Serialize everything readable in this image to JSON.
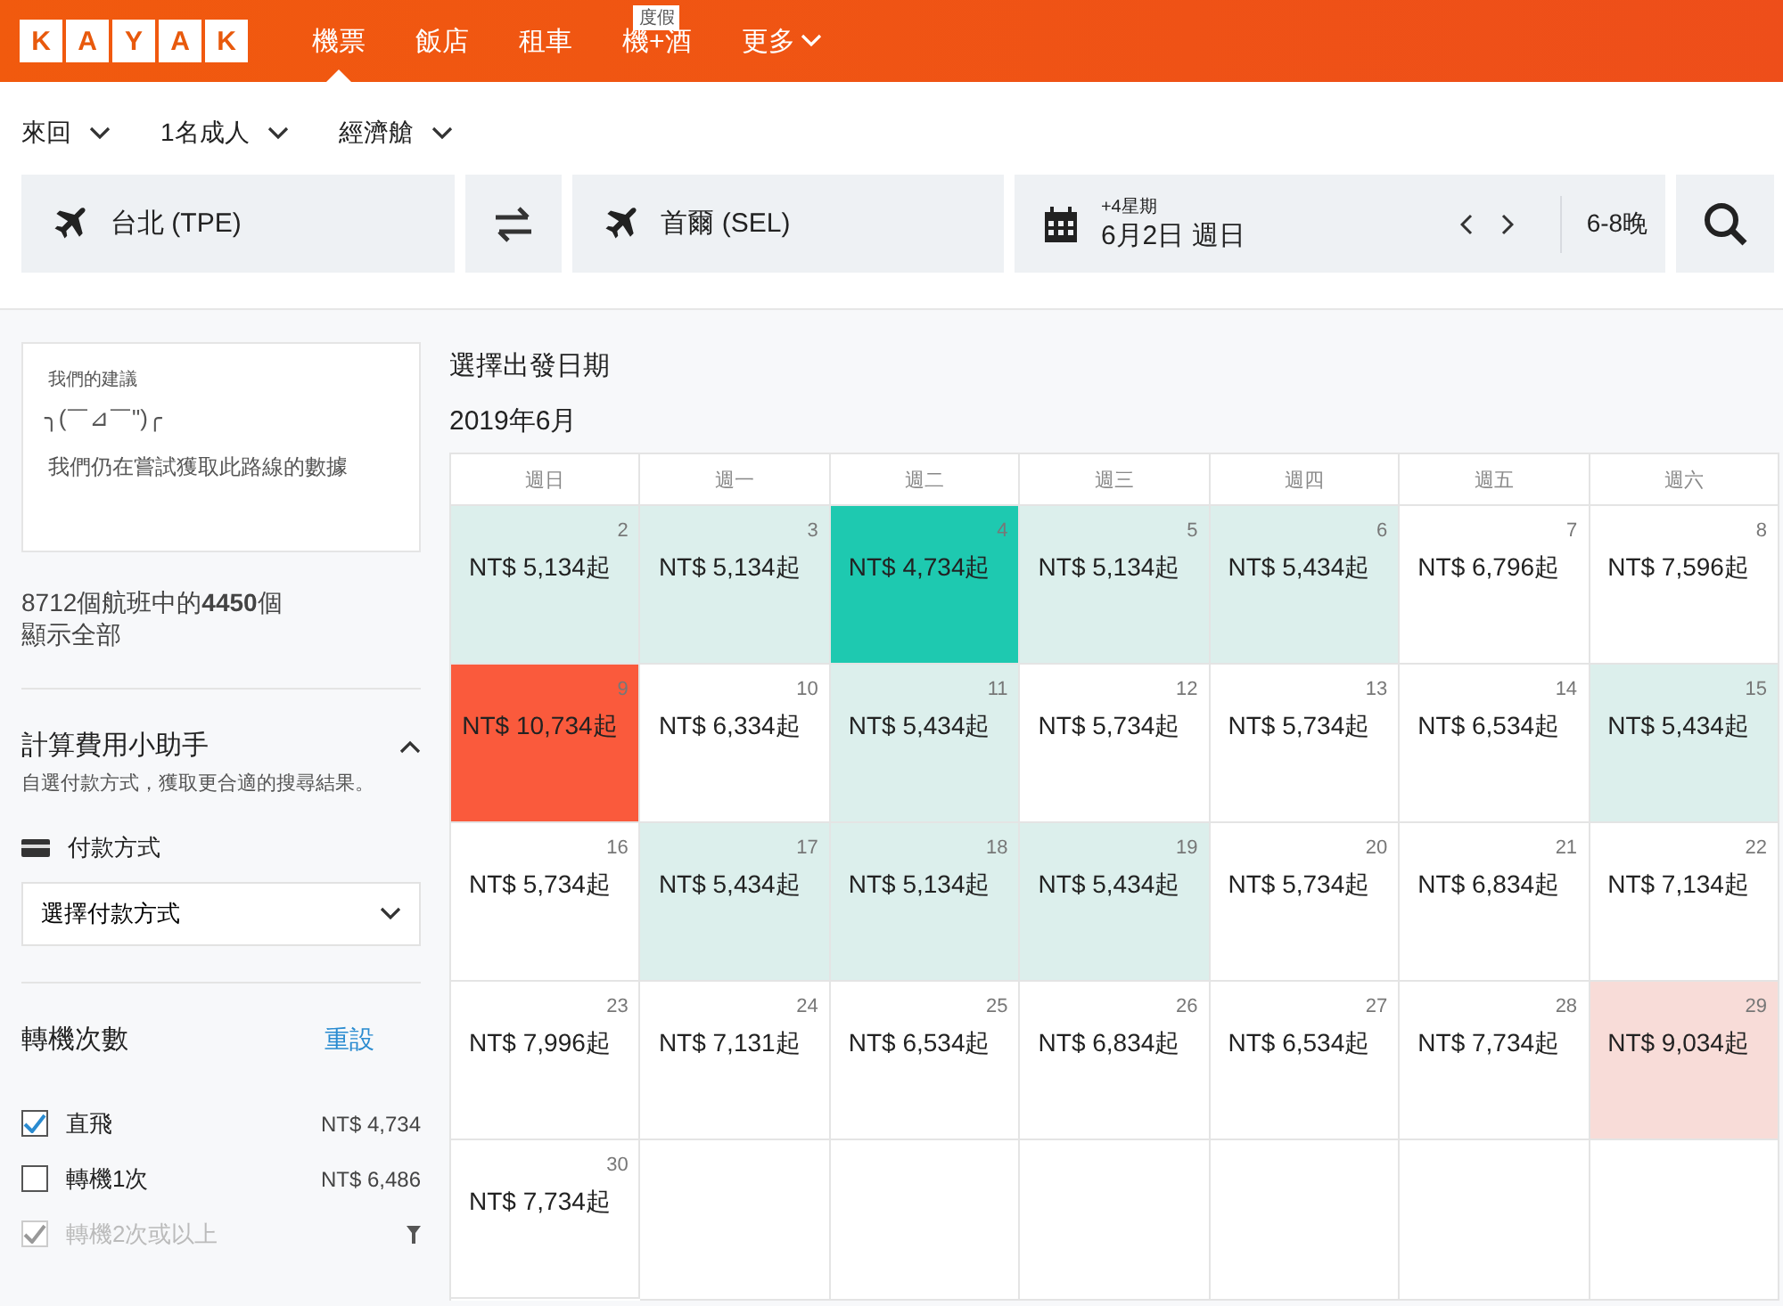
{
  "header": {
    "logo": [
      "K",
      "A",
      "Y",
      "A",
      "K"
    ],
    "nav": [
      {
        "label": "機票",
        "selected": true
      },
      {
        "label": "飯店",
        "selected": false
      },
      {
        "label": "租車",
        "selected": false
      },
      {
        "label": "機+酒",
        "selected": false,
        "badge": "度假"
      },
      {
        "label": "更多",
        "selected": false,
        "dropdown": true
      }
    ]
  },
  "options": [
    "來回",
    "1名成人",
    "經濟艙"
  ],
  "search": {
    "origin": "台北 (TPE)",
    "destination": "首爾 (SEL)",
    "date_hint": "+4星期",
    "date": "6月2日 週日",
    "nights": "6-8晚"
  },
  "sidebar": {
    "tip": {
      "title": "我們的建議",
      "face": "╮(￣⊿￣\")╭",
      "message": "我們仍在嘗試獲取此路線的數據"
    },
    "count": "8712個航班中的**4450**個",
    "show_all": "顯示全部",
    "fee_helper": {
      "title": "計算費用小助手",
      "expanded": true,
      "subtitle": "自選付款方式，獲取更合適的搜尋結果。",
      "payment_label": "付款方式",
      "payment_placeholder": "選擇付款方式"
    },
    "stops": {
      "title": "轉機次數",
      "reset": "重設",
      "options": [
        {
          "label": "直飛",
          "price": "NT$ 4,734",
          "checked": true,
          "disabled": false
        },
        {
          "label": "轉機1次",
          "price": "NT$ 6,486",
          "checked": false,
          "disabled": false
        },
        {
          "label": "轉機2次或以上",
          "checked": true,
          "disabled": true
        }
      ]
    }
  },
  "calendar": {
    "title": "選擇出發日期",
    "month": "2019年6月",
    "weekdays": [
      "週日",
      "週一",
      "週二",
      "週三",
      "週四",
      "週五",
      "週六"
    ],
    "weeks": [
      [
        {
          "day": "2",
          "price": "NT$ 5,134起",
          "color": "#dcefec"
        },
        {
          "day": "3",
          "price": "NT$ 5,134起",
          "color": "#dcefec"
        },
        {
          "day": "4",
          "price": "NT$ 4,734起",
          "color": "#1ec9b0"
        },
        {
          "day": "5",
          "price": "NT$ 5,134起",
          "color": "#dcefec"
        },
        {
          "day": "6",
          "price": "NT$ 5,434起",
          "color": "#dcefec"
        },
        {
          "day": "7",
          "price": "NT$ 6,796起",
          "color": "#ffffff"
        },
        {
          "day": "8",
          "price": "NT$ 7,596起",
          "color": "#ffffff"
        }
      ],
      [
        {
          "day": "9",
          "price": "NT$ 10,734起",
          "color": "#fa5a3c"
        },
        {
          "day": "10",
          "price": "NT$ 6,334起",
          "color": "#ffffff"
        },
        {
          "day": "11",
          "price": "NT$ 5,434起",
          "color": "#dcefec"
        },
        {
          "day": "12",
          "price": "NT$ 5,734起",
          "color": "#ffffff"
        },
        {
          "day": "13",
          "price": "NT$ 5,734起",
          "color": "#ffffff"
        },
        {
          "day": "14",
          "price": "NT$ 6,534起",
          "color": "#ffffff"
        },
        {
          "day": "15",
          "price": "NT$ 5,434起",
          "color": "#dcefec"
        }
      ],
      [
        {
          "day": "16",
          "price": "NT$ 5,734起",
          "color": "#ffffff"
        },
        {
          "day": "17",
          "price": "NT$ 5,434起",
          "color": "#dcefec"
        },
        {
          "day": "18",
          "price": "NT$ 5,134起",
          "color": "#dcefec"
        },
        {
          "day": "19",
          "price": "NT$ 5,434起",
          "color": "#dcefec"
        },
        {
          "day": "20",
          "price": "NT$ 5,734起",
          "color": "#ffffff"
        },
        {
          "day": "21",
          "price": "NT$ 6,834起",
          "color": "#ffffff"
        },
        {
          "day": "22",
          "price": "NT$ 7,134起",
          "color": "#ffffff"
        }
      ],
      [
        {
          "day": "23",
          "price": "NT$ 7,996起",
          "color": "#ffffff"
        },
        {
          "day": "24",
          "price": "NT$ 7,131起",
          "color": "#ffffff"
        },
        {
          "day": "25",
          "price": "NT$ 6,534起",
          "color": "#ffffff"
        },
        {
          "day": "26",
          "price": "NT$ 6,834起",
          "color": "#ffffff"
        },
        {
          "day": "27",
          "price": "NT$ 6,534起",
          "color": "#ffffff"
        },
        {
          "day": "28",
          "price": "NT$ 7,734起",
          "color": "#ffffff"
        },
        {
          "day": "29",
          "price": "NT$ 9,034起",
          "color": "#f8dcd8"
        }
      ],
      [
        {
          "day": "30",
          "price": "NT$ 7,734起",
          "color": "#ffffff"
        }
      ]
    ]
  }
}
